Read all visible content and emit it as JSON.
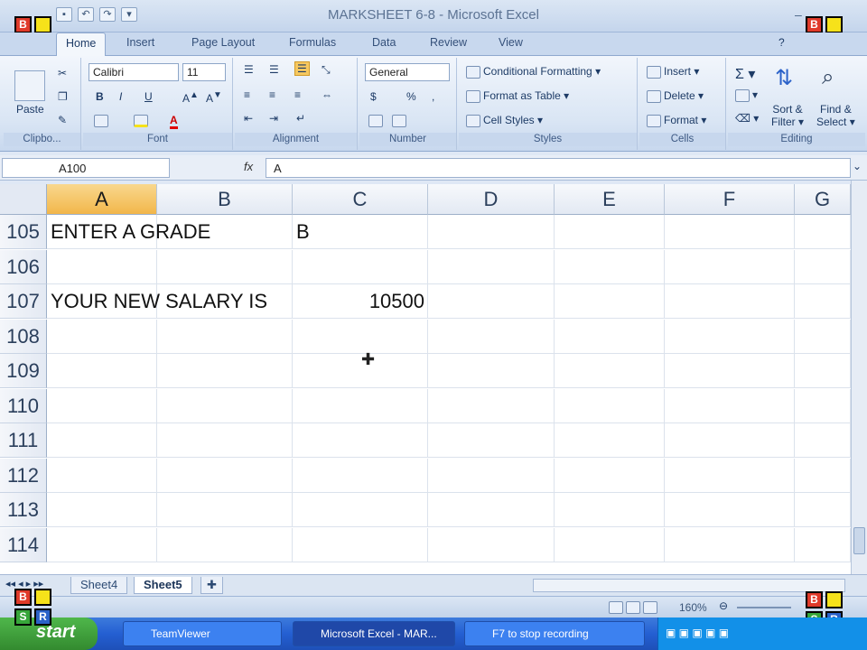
{
  "window": {
    "title": "MARKSHEET 6-8 - Microsoft Excel"
  },
  "logo": {
    "letters": [
      "B",
      "",
      "S",
      "R"
    ]
  },
  "tabs": [
    "Home",
    "Insert",
    "Page Layout",
    "Formulas",
    "Data",
    "Review",
    "View"
  ],
  "ribbon": {
    "clipboard": {
      "paste": "Paste",
      "label": "Clipbo..."
    },
    "font": {
      "name": "Calibri",
      "size": "11",
      "label": "Font",
      "bold": "B",
      "italic": "I",
      "underline": "U"
    },
    "alignment": {
      "label": "Alignment"
    },
    "number": {
      "format": "General",
      "currency": "$",
      "percent": "%",
      "label": "Number"
    },
    "styles": {
      "conditional": "Conditional Formatting",
      "format_table": "Format as Table",
      "cell_styles": "Cell Styles",
      "label": "Styles"
    },
    "cells": {
      "insert": "Insert",
      "delete": "Delete",
      "format": "Format",
      "label": "Cells"
    },
    "editing": {
      "sort": "Sort &",
      "filter": "Filter",
      "find": "Find &",
      "select": "Select",
      "label": "Editing"
    }
  },
  "formula_bar": {
    "name_box": "A100",
    "fx": "fx",
    "formula": "A"
  },
  "columns": [
    "A",
    "B",
    "C",
    "D",
    "E",
    "F",
    "G"
  ],
  "rows": [
    {
      "num": "105",
      "a": "ENTER A GRADE",
      "c": "B",
      "c_right": ""
    },
    {
      "num": "106",
      "a": "",
      "c": "",
      "c_right": ""
    },
    {
      "num": "107",
      "a": "YOUR NEW SALARY IS",
      "c": "",
      "c_right": "10500"
    },
    {
      "num": "108",
      "a": "",
      "c": "",
      "c_right": ""
    },
    {
      "num": "109",
      "a": "",
      "c": "",
      "c_right": ""
    },
    {
      "num": "110",
      "a": "",
      "c": "",
      "c_right": ""
    },
    {
      "num": "111",
      "a": "",
      "c": "",
      "c_right": ""
    },
    {
      "num": "112",
      "a": "",
      "c": "",
      "c_right": ""
    },
    {
      "num": "113",
      "a": "",
      "c": "",
      "c_right": ""
    },
    {
      "num": "114",
      "a": "",
      "c": "",
      "c_right": ""
    }
  ],
  "sheets": [
    "Sheet4",
    "Sheet5"
  ],
  "status": {
    "zoom": "160%"
  },
  "taskbar": {
    "start": "start",
    "items": [
      "TeamViewer",
      "Microsoft Excel - MAR...",
      "F7 to stop recording"
    ]
  },
  "colors": {
    "accent": "#f2b64a",
    "ribbon": "#d9e5f4",
    "taskbar": "#245fd2"
  }
}
